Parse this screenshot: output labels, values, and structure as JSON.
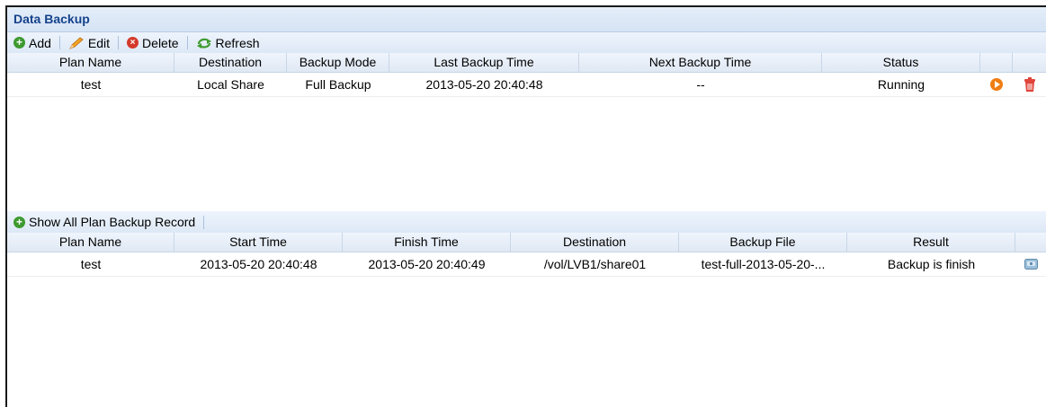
{
  "panel": {
    "title": "Data Backup"
  },
  "toolbar": {
    "add_label": "Add",
    "edit_label": "Edit",
    "delete_label": "Delete",
    "refresh_label": "Refresh"
  },
  "plans": {
    "columns": [
      "Plan Name",
      "Destination",
      "Backup Mode",
      "Last Backup Time",
      "Next Backup Time",
      "Status"
    ],
    "rows": [
      {
        "plan_name": "test",
        "destination": "Local Share",
        "backup_mode": "Full Backup",
        "last_backup_time": "2013-05-20 20:40:48",
        "next_backup_time": "--",
        "status": "Running"
      }
    ]
  },
  "records_toolbar": {
    "show_all_label": "Show All Plan Backup Record"
  },
  "records": {
    "columns": [
      "Plan Name",
      "Start Time",
      "Finish Time",
      "Destination",
      "Backup File",
      "Result"
    ],
    "rows": [
      {
        "plan_name": "test",
        "start_time": "2013-05-20 20:40:48",
        "finish_time": "2013-05-20 20:40:49",
        "destination": "/vol/LVB1/share01",
        "backup_file": "test-full-2013-05-20-...",
        "result": "Backup is finish"
      }
    ]
  },
  "icons": {
    "add": "add-circle-icon",
    "edit": "pencil-icon",
    "delete": "delete-circle-icon",
    "refresh": "refresh-icon",
    "start": "play-icon",
    "remove": "trash-icon",
    "download": "disk-icon"
  },
  "colors": {
    "title_text": "#15428b",
    "accent_orange": "#ef7d12",
    "delete_red": "#d43a2b",
    "add_green": "#3d9a2f"
  }
}
